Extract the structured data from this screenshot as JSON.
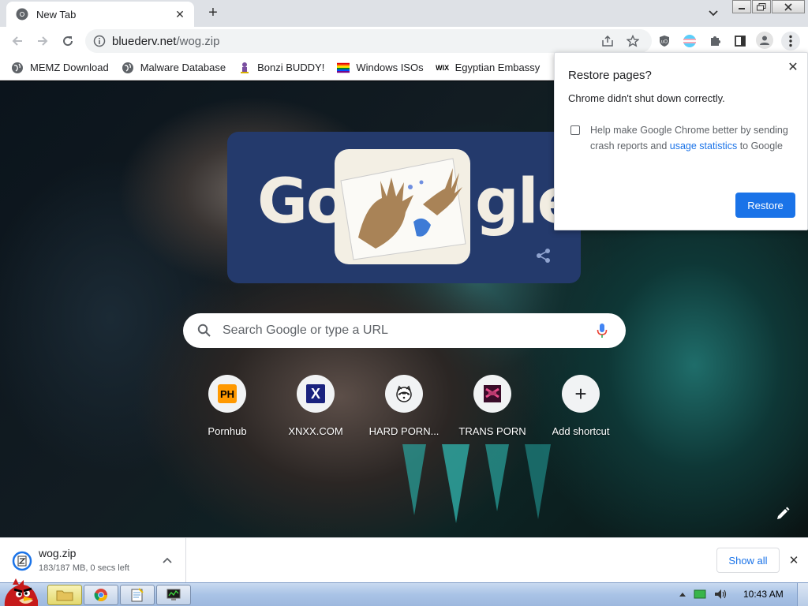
{
  "browser": {
    "tab": {
      "title": "New Tab"
    },
    "address": {
      "host": "bluederv.net",
      "path": "/wog.zip"
    }
  },
  "bookmarks": [
    {
      "label": "MEMZ Download",
      "icon": "globe-icon"
    },
    {
      "label": "Malware Database",
      "icon": "globe-icon"
    },
    {
      "label": "Bonzi BUDDY!",
      "icon": "bonzi-icon"
    },
    {
      "label": "Windows ISOs",
      "icon": "rainbow-flag-icon"
    },
    {
      "label": "Egyptian Embassy",
      "icon": "wix-icon"
    }
  ],
  "doodle": {
    "left_text": "Go",
    "right_text": "gle"
  },
  "search": {
    "placeholder": "Search Google or type a URL"
  },
  "shortcuts": [
    {
      "label": "Pornhub",
      "icon_text": "PH"
    },
    {
      "label": "XNXX.COM",
      "icon_text": "X"
    },
    {
      "label": "HARD PORN...",
      "icon_text": ""
    },
    {
      "label": "TRANS PORN",
      "icon_text": ""
    },
    {
      "label": "Add shortcut",
      "icon_text": "+"
    }
  ],
  "restore_dialog": {
    "title": "Restore pages?",
    "message": "Chrome didn't shut down correctly.",
    "checkbox_text_before": "Help make Google Chrome better by sending crash reports and ",
    "checkbox_link": "usage statistics",
    "checkbox_text_after": " to Google",
    "button": "Restore"
  },
  "download": {
    "filename": "wog.zip",
    "status": "183/187 MB, 0 secs left",
    "show_all": "Show all"
  },
  "taskbar": {
    "clock": "10:43 AM"
  },
  "colors": {
    "accent": "#1a73e8",
    "doodle_bg": "#243a6c",
    "tabstrip": "#dee1e6",
    "ph_orange": "#ff9900"
  }
}
